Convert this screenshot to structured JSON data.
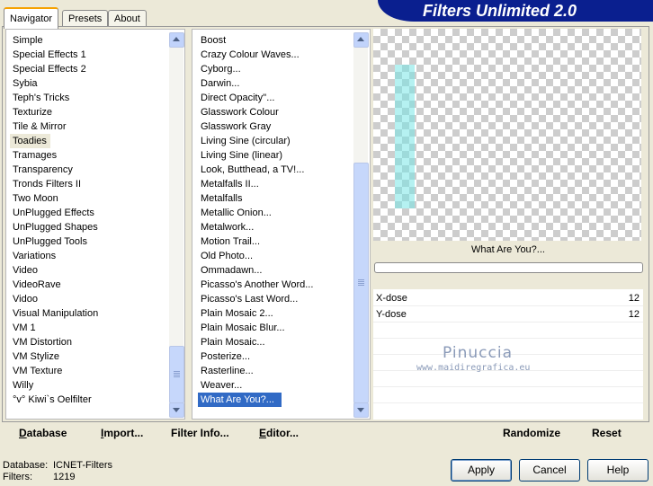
{
  "header": {
    "title": "Filters Unlimited 2.0"
  },
  "tabs": [
    {
      "label": "Navigator",
      "active": true
    },
    {
      "label": "Presets",
      "active": false
    },
    {
      "label": "About",
      "active": false
    }
  ],
  "categories": {
    "items": [
      "Simple",
      "Special Effects 1",
      "Special Effects 2",
      "Sybia",
      "Teph's Tricks",
      "Texturize",
      "Tile & Mirror",
      "Toadies",
      "Tramages",
      "Transparency",
      "Tronds Filters II",
      "Two Moon",
      "UnPlugged Effects",
      "UnPlugged Shapes",
      "UnPlugged Tools",
      "Variations",
      "Video",
      "VideoRave",
      "Vidoo",
      "Visual Manipulation",
      "VM 1",
      "VM Distortion",
      "VM Stylize",
      "VM Texture",
      "Willy",
      "°v° Kiwi`s Oelfilter"
    ],
    "selected": "Toadies"
  },
  "filters": {
    "items": [
      "Boost",
      "Crazy Colour Waves...",
      "Cyborg...",
      "Darwin...",
      "Direct Opacity''...",
      "Glasswork Colour",
      "Glasswork Gray",
      "Living Sine (circular)",
      "Living Sine (linear)",
      "Look, Butthead, a TV!...",
      "Metalfalls II...",
      "Metalfalls",
      "Metallic Onion...",
      "Metalwork...",
      "Motion Trail...",
      "Old Photo...",
      "Ommadawn...",
      "Picasso's Another Word...",
      "Picasso's Last Word...",
      "Plain Mosaic 2...",
      "Plain Mosaic Blur...",
      "Plain Mosaic...",
      "Posterize...",
      "Rasterline...",
      "Weaver...",
      "What Are You?..."
    ],
    "selected": "What Are You?..."
  },
  "filter_name": "What Are You?...",
  "progress": 0,
  "params": [
    {
      "label": "X-dose",
      "value": "12"
    },
    {
      "label": "Y-dose",
      "value": "12"
    }
  ],
  "watermark": {
    "name": "Pinuccia",
    "url": "www.maidiregrafica.eu"
  },
  "toolbar": {
    "database": {
      "ul": "D",
      "rest": "atabase"
    },
    "import": {
      "ul": "I",
      "rest": "mport..."
    },
    "filter_info": {
      "ul": "",
      "rest": "Filter Info..."
    },
    "editor": {
      "ul": "E",
      "rest": "ditor..."
    },
    "randomize": "Randomize",
    "reset": "Reset"
  },
  "status": {
    "database_label": "Database:",
    "database_value": "ICNET-Filters",
    "filters_label": "Filters:",
    "filters_value": "1219"
  },
  "buttons": {
    "apply": "Apply",
    "cancel": "Cancel",
    "help": "Help"
  },
  "colors": {
    "banner": "#0A1F8F",
    "selection": "#316AC5",
    "accent_tab": "#F6A100"
  }
}
